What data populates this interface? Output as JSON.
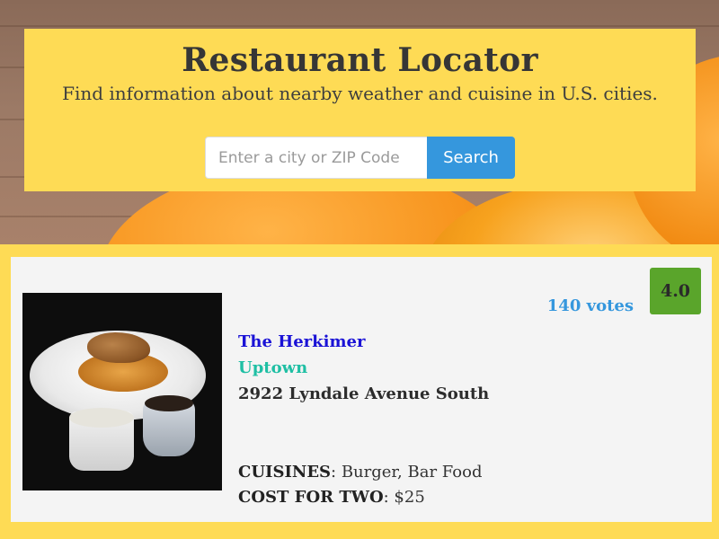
{
  "header": {
    "title": "Restaurant Locator",
    "subtitle": "Find information about nearby weather and cuisine in U.S. cities."
  },
  "search": {
    "placeholder": "Enter a city or ZIP Code",
    "value": "",
    "button_label": "Search"
  },
  "results": [
    {
      "name": "The Herkimer",
      "locality": "Uptown",
      "address": "2922 Lyndale Avenue South",
      "rating": "4.0",
      "votes": "140 votes",
      "cuisines_label": "CUISINES",
      "cuisines": ": Burger, Bar Food",
      "cost_label": "COST FOR TWO",
      "cost": ": $25"
    }
  ],
  "colors": {
    "page_background": "#fedb55",
    "search_button": "#3597dd",
    "rating_badge": "#5aa52b",
    "name_link": "#1a12d6",
    "locality": "#1fbfa4",
    "votes": "#3597dd"
  }
}
